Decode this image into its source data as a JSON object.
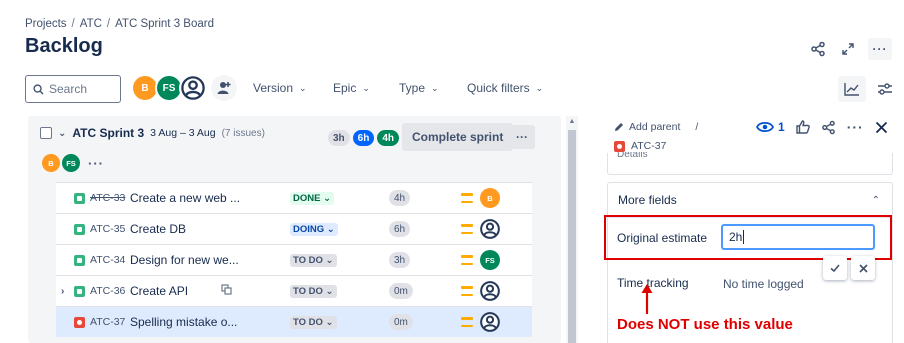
{
  "breadcrumb": [
    "Projects",
    "ATC",
    "ATC Sprint 3 Board"
  ],
  "breadcrumb_separator": "/",
  "page_title": "Backlog",
  "search": {
    "placeholder": "Search"
  },
  "assignee_avatars": [
    {
      "initials": "B",
      "color": "#ff991f"
    },
    {
      "initials": "FS",
      "color": "#00875a"
    }
  ],
  "filters": [
    "Version",
    "Epic",
    "Type",
    "Quick filters"
  ],
  "sprint": {
    "name": "ATC Sprint 3",
    "dates": "3 Aug – 3 Aug",
    "issue_count": "(7 issues)",
    "estimates": [
      "3h",
      "6h",
      "4h"
    ],
    "complete_label": "Complete sprint",
    "assignees": [
      "B",
      "FS"
    ]
  },
  "issues": [
    {
      "key": "ATC-33",
      "summary": "Create a new web ...",
      "status": "DONE",
      "estimate": "4h",
      "assignee": "B",
      "type": "story",
      "done": true
    },
    {
      "key": "ATC-35",
      "summary": "Create DB",
      "status": "DOING",
      "estimate": "6h",
      "assignee": "",
      "type": "story",
      "done": false
    },
    {
      "key": "ATC-34",
      "summary": "Design for new we...",
      "status": "TO DO",
      "estimate": "3h",
      "assignee": "FS",
      "type": "story",
      "done": false
    },
    {
      "key": "ATC-36",
      "summary": "Create API",
      "status": "TO DO",
      "estimate": "0m",
      "assignee": "",
      "type": "story",
      "done": false
    },
    {
      "key": "ATC-37",
      "summary": "Spelling mistake o...",
      "status": "TO DO",
      "estimate": "0m",
      "assignee": "",
      "type": "bug",
      "done": false
    }
  ],
  "detail": {
    "add_parent": "Add parent",
    "separator": "/",
    "issue_key": "ATC-37",
    "watch_count": "1",
    "partial_field_label": "Details",
    "more_fields_label": "More fields",
    "original_estimate_label": "Original estimate",
    "original_estimate_value": "2h",
    "time_tracking_label": "Time tracking",
    "time_tracking_value": "No time logged"
  },
  "annotation": "Does NOT use this value",
  "colors": {
    "annotation_red": "#e00000",
    "story_green": "#36b37e",
    "bug_red": "#e5493a",
    "priority_medium": "#ffab00",
    "focus_blue": "#4c9aff"
  }
}
